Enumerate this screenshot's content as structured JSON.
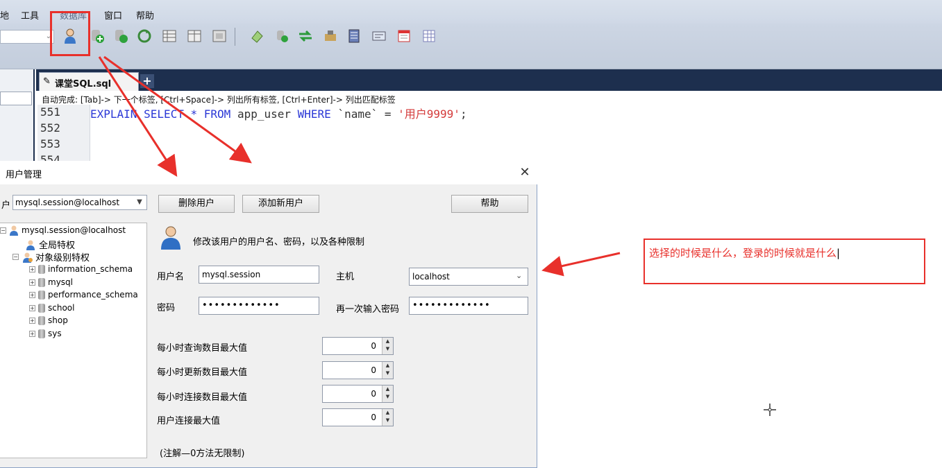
{
  "menu": [
    "地",
    "工具",
    "数据库",
    "窗口",
    "帮助"
  ],
  "toolbar": {
    "icon_names": [
      "user-manager-icon",
      "add-db-icon",
      "import-icon",
      "refresh-icon",
      "table-icon",
      "view-icon",
      "grid-icon",
      "schema-icon",
      "backup-icon",
      "sync-icon",
      "data-sync-icon",
      "server-icon",
      "report-icon",
      "calendar-icon",
      "sheet-icon"
    ]
  },
  "editor": {
    "tab_label": "课堂SQL.sql",
    "tab_add": "+",
    "autocomplete": "自动完成: [Tab]-> 下一个标签, [Ctrl+Space]-> 列出所有标签, [Ctrl+Enter]-> 列出匹配标签",
    "line_numbers": [
      "551",
      "552",
      "553",
      "554"
    ],
    "sql": {
      "kw1": "EXPLAIN",
      "kw2": "SELECT",
      "star": " * ",
      "kw3": "FROM",
      "table": " app_user ",
      "kw4": "WHERE",
      "col": " `name` = ",
      "val": "'用户9999'",
      "end": ";"
    }
  },
  "dialog": {
    "title": "用户管理",
    "close": "✕",
    "user_label": "户",
    "user_selected": "mysql.session@localhost",
    "btn_delete": "删除用户",
    "btn_add": "添加新用户",
    "btn_help": "帮助",
    "tree": {
      "root": "mysql.session@localhost",
      "global": "全局特权",
      "object": "对象级别特权",
      "dbs": [
        "information_schema",
        "mysql",
        "performance_schema",
        "school",
        "shop",
        "sys"
      ]
    },
    "description": "修改该用户的用户名、密码，以及各种限制",
    "username_label": "用户名",
    "username_value": "mysql.session",
    "host_label": "主机",
    "host_value": "localhost",
    "password_label": "密码",
    "password_value": "•••••••••••••",
    "password2_label": "再一次输入密码",
    "password2_value": "•••••••••••••",
    "limits": [
      {
        "label": "每小时查询数目最大值",
        "value": "0"
      },
      {
        "label": "每小时更新数目最大值",
        "value": "0"
      },
      {
        "label": "每小时连接数目最大值",
        "value": "0"
      },
      {
        "label": "用户连接最大值",
        "value": "0"
      }
    ],
    "note": "(注解—0方法无限制)"
  },
  "annotation": {
    "text": "选择的时候是什么，登录的时候就是什么"
  },
  "colors": {
    "accent_red": "#e8302b",
    "tab_bar": "#1d2f4e",
    "keyword": "#2b38d6",
    "string": "#d43a3a"
  }
}
